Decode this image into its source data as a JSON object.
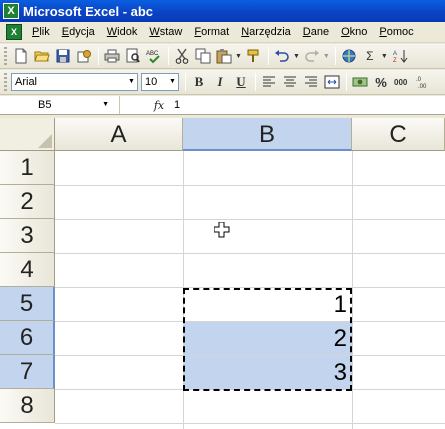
{
  "window": {
    "title": "Microsoft Excel - abc"
  },
  "menu": [
    "Plik",
    "Edycja",
    "Widok",
    "Wstaw",
    "Format",
    "Narzędzia",
    "Dane",
    "Okno",
    "Pomoc"
  ],
  "toolbar": {
    "font_name": "Arial",
    "font_size": "10",
    "bold_label": "B",
    "italic_label": "I",
    "underline_label": "U",
    "percent_label": "%",
    "sigma_label": "Σ"
  },
  "formula_bar": {
    "name_box": "B5",
    "fx_label": "fx",
    "value": "1"
  },
  "sheet": {
    "columns": [
      "A",
      "B",
      "C"
    ],
    "rows": [
      "1",
      "2",
      "3",
      "4",
      "5",
      "6",
      "7",
      "8"
    ],
    "cells": {
      "B5": "1",
      "B6": "2",
      "B7": "3"
    },
    "selected_column": "B",
    "selected_rows": [
      "5",
      "6",
      "7"
    ],
    "active_cell": "B5",
    "selection_color": "#c3d5ee"
  }
}
